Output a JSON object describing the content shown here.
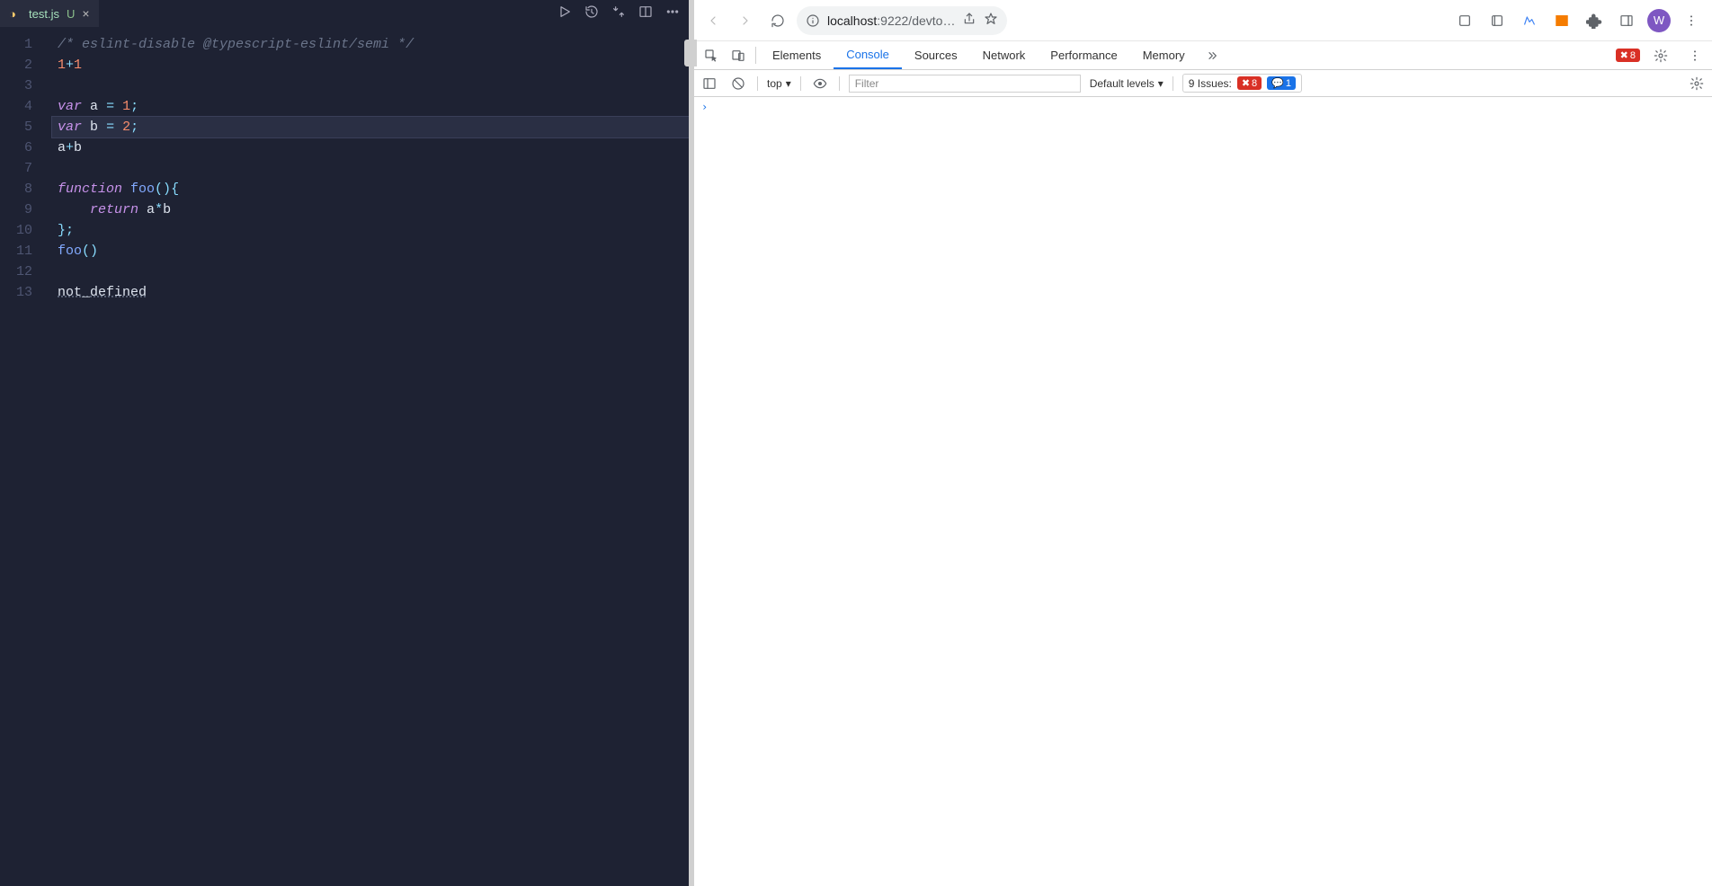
{
  "editor": {
    "tab": {
      "filename": "test.js",
      "status": "U"
    },
    "lines": [
      "1",
      "2",
      "3",
      "4",
      "5",
      "6",
      "7",
      "8",
      "9",
      "10",
      "11",
      "12",
      "13"
    ],
    "code": {
      "l1_comment": "/* eslint-disable @typescript-eslint/semi */",
      "l2_a": "1",
      "l2_op": "+",
      "l2_b": "1",
      "l4_kw": "var",
      "l4_id": "a",
      "l4_eq": "=",
      "l4_v": "1",
      "l4_sc": ";",
      "l5_kw": "var",
      "l5_id": "b",
      "l5_eq": "=",
      "l5_v": "2",
      "l5_sc": ";",
      "l6_a": "a",
      "l6_op": "+",
      "l6_b": "b",
      "l8_kw": "function",
      "l8_name": "foo",
      "l8_paren": "()",
      "l8_ob": "{",
      "l9_kw": "return",
      "l9_a": "a",
      "l9_op": "*",
      "l9_b": "b",
      "l10_cb": "}",
      "l10_sc": ";",
      "l11_name": "foo",
      "l11_call": "()",
      "l13_id": "not_defined"
    }
  },
  "browser": {
    "url_host": "localhost",
    "url_port_path": ":9222/devto…",
    "avatar_initial": "W",
    "devtools_tabs": {
      "elements": "Elements",
      "console": "Console",
      "sources": "Sources",
      "network": "Network",
      "performance": "Performance",
      "memory": "Memory"
    },
    "error_badge": "8",
    "console": {
      "context": "top",
      "filter_placeholder": "Filter",
      "levels": "Default levels",
      "issues_label": "9 Issues:",
      "issues_err": "8",
      "issues_info": "1",
      "prompt": "›"
    }
  }
}
